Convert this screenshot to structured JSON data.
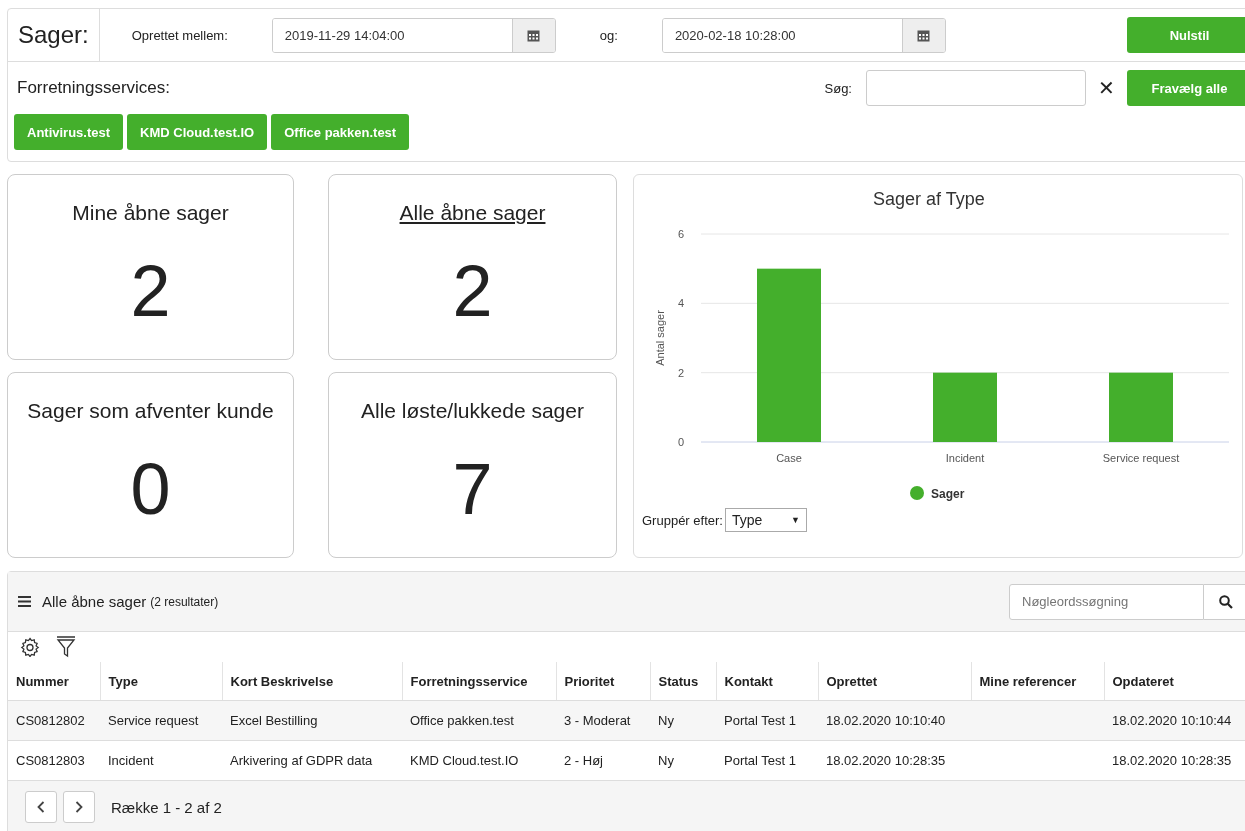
{
  "filter_bar": {
    "title": "Sager:",
    "created_label": "Oprettet mellem:",
    "from_date": "2019-11-29 14:04:00",
    "and_label": "og:",
    "to_date": "2020-02-18 10:28:00",
    "reset_button": "Nulstil",
    "services_label": "Forretningsservices:",
    "search_label": "Søg:",
    "clear_icon": "✕",
    "deselect_button": "Fravælg alle",
    "services": [
      {
        "label": "Antivirus.test"
      },
      {
        "label": "KMD Cloud.test.IO"
      },
      {
        "label": "Office pakken.test"
      }
    ]
  },
  "cards": [
    {
      "title": "Mine åbne sager",
      "count": "2",
      "link": false
    },
    {
      "title": "Alle åbne sager",
      "count": "2",
      "link": true
    },
    {
      "title": "Sager som afventer kunde",
      "count": "0",
      "link": false
    },
    {
      "title": "Alle løste/lukkede sager",
      "count": "7",
      "link": false
    }
  ],
  "chart": {
    "group_label": "Gruppér efter:",
    "group_value": "Type",
    "group_caret": "▼",
    "chart_data": {
      "type": "bar",
      "title": "Sager af Type",
      "ylabel": "Antal sager",
      "categories": [
        "Case",
        "Incident",
        "Service request"
      ],
      "series": [
        {
          "name": "Sager",
          "color": "#44af2c",
          "values": [
            5,
            2,
            2
          ]
        }
      ],
      "ylim": [
        0,
        6
      ],
      "yticks": [
        0,
        2,
        4,
        6
      ]
    }
  },
  "list": {
    "title": "Alle åbne sager",
    "count": "(2 resultater)",
    "search_placeholder": "Nøgleordssøgning",
    "columns": [
      "Nummer",
      "Type",
      "Kort Beskrivelse",
      "Forretningsservice",
      "Prioritet",
      "Status",
      "Kontakt",
      "Oprettet",
      "Mine referencer",
      "Opdateret"
    ],
    "rows": [
      [
        "CS0812802",
        "Service request",
        "Excel Bestilling",
        "Office pakken.test",
        "3 - Moderat",
        "Ny",
        "Portal Test 1",
        "18.02.2020 10:10:40",
        "",
        "18.02.2020 10:10:44"
      ],
      [
        "CS0812803",
        "Incident",
        "Arkivering af GDPR data",
        "KMD Cloud.test.IO",
        "2 - Høj",
        "Ny",
        "Portal Test 1",
        "18.02.2020 10:28:35",
        "",
        "18.02.2020 10:28:35"
      ]
    ],
    "pager": "Række 1 - 2 af 2"
  }
}
